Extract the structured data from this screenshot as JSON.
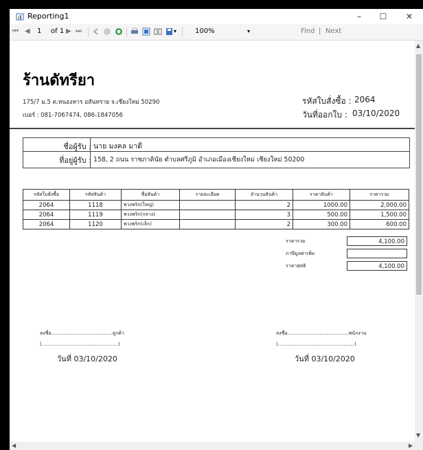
{
  "window": {
    "title": "Reporting1",
    "minimize": "–",
    "maximize": "☐",
    "close": "✕"
  },
  "toolbar": {
    "first": "⏮",
    "prev": "◀",
    "page": "1",
    "of_label": "of 1",
    "next": "▶",
    "last": "⏭",
    "zoom": "100%",
    "zoom_caret": "▾",
    "find": "Find",
    "sep": "|",
    "next_link": "Next"
  },
  "report": {
    "shop_name": "ร้านดัทรียา",
    "address": "175/7 ม.5 ต.หนองหาร อสันทราย จ.เชียงใหม่ 50290",
    "phone": "เบอร์ : 081-7067474, 086-1847056",
    "order_id_label": "รหัสใบสั่งซื้อ :",
    "order_id": "2064",
    "issue_date_label": "วันที่ออกใบ :",
    "issue_date": "03/10/2020",
    "receiver_label": "ชื่อผู้รับ :",
    "receiver": "นาย มงคล มาดี",
    "receiver_addr_label": "ที่อยู่ผู้รับ :",
    "receiver_addr": "158, 2 ถนน ราชภาคินัย ตำบลศรีภูมิ อำเภอเมืองเชียงใหม่ เชียงใหม่ 50200",
    "table": {
      "headers": [
        "รหัสใบสั่งซื้อ",
        "รหัสสินค้า",
        "ชื่อสินค้า",
        "รายละเอียด",
        "จำนวนสินค้า",
        "ราคาสินค้า",
        "ราคารวม"
      ],
      "rows": [
        [
          "2064",
          "1118",
          "พวงพริก(ใหญ่)",
          "",
          "2",
          "1000.00",
          "2,000.00"
        ],
        [
          "2064",
          "1119",
          "พวงพริก(กลาง)",
          "",
          "3",
          "500.00",
          "1,500.00"
        ],
        [
          "2064",
          "1120",
          "พวงพริก(เล็ก)",
          "",
          "2",
          "300.00",
          "600.00"
        ]
      ]
    },
    "totals": {
      "subtotal_label": "ราคารวม",
      "subtotal": "4,100.00",
      "vat_label": "ภาษีมูลค่าเพิ่ม",
      "vat": "",
      "net_label": "ราคาสุทธิ",
      "net": "4,100.00"
    },
    "sign_left": {
      "line": "ลงชื่อ........................................ลูกค้า",
      "paren": "(..................................................)",
      "date": "วันที่ 03/10/2020"
    },
    "sign_right": {
      "line": "ลงชื่อ........................................พนักงาน",
      "paren": "(..................................................)",
      "date": "วันที่ 03/10/2020"
    }
  }
}
